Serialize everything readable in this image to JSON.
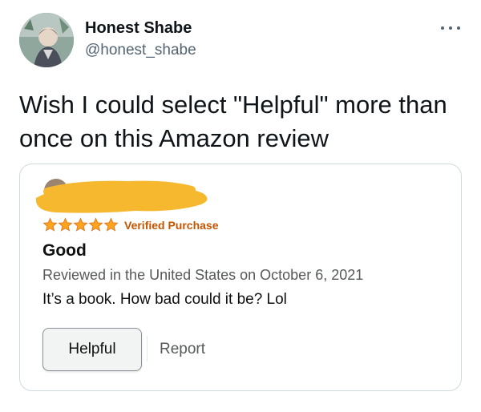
{
  "tweet": {
    "author": {
      "display_name": "Honest Shabe",
      "handle": "@honest_shabe"
    },
    "more_icon": "more-horizontal-icon",
    "text": "Wish I could select \"Helpful\" more than once on this Amazon review"
  },
  "review": {
    "reviewer_name_redacted": true,
    "rating_stars": 5,
    "rating_max": 5,
    "verified_label": "Verified Purchase",
    "title": "Good",
    "meta": "Reviewed in the United States on October 6, 2021",
    "body": "It’s a book. How bad could it be? Lol",
    "helpful_label": "Helpful",
    "report_label": "Report"
  },
  "colors": {
    "star": "#ffa41c",
    "verified": "#c45500",
    "redaction": "#f5b82e",
    "handle": "#536471",
    "card_border": "#cfd9de"
  }
}
